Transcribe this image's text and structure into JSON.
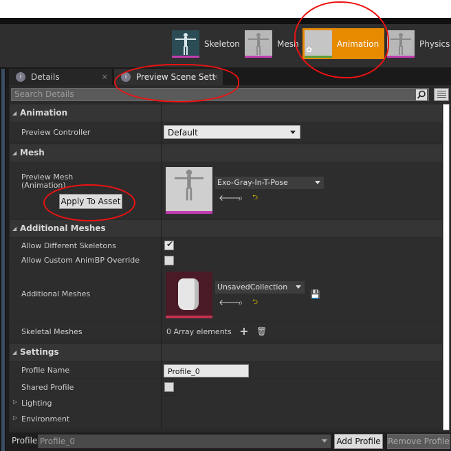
{
  "mode_tabs": [
    {
      "label": "Skeleton",
      "icon": "skeleton-thumb-icon"
    },
    {
      "label": "Mesh",
      "icon": "mesh-thumb-icon"
    },
    {
      "label": "Animation",
      "icon": "animation-thumb-icon",
      "active": true
    },
    {
      "label": "Physics",
      "icon": "physics-thumb-icon"
    }
  ],
  "panel_tabs": [
    {
      "label": "Details",
      "icon": "details-icon"
    },
    {
      "label": "Preview Scene Sett",
      "icon": "preview-scene-icon",
      "active": true
    }
  ],
  "search": {
    "placeholder": "Search Details"
  },
  "sections": {
    "animation": {
      "title": "Animation",
      "preview_controller_label": "Preview Controller",
      "preview_controller_value": "Default"
    },
    "mesh": {
      "title": "Mesh",
      "preview_mesh_label": "Preview Mesh\n(Animation)",
      "apply_button": "Apply To Asset",
      "mesh_value": "Exo-Gray-In-T-Pose"
    },
    "additional_meshes": {
      "title": "Additional Meshes",
      "allow_different_skeletons_label": "Allow Different Skeletons",
      "allow_different_skeletons_checked": true,
      "allow_custom_animbp_label": "Allow Custom AnimBP Override",
      "allow_custom_animbp_checked": false,
      "additional_meshes_label": "Additional Meshes",
      "collection_value": "UnsavedCollection",
      "skeletal_meshes_label": "Skeletal Meshes",
      "skeletal_meshes_value": "0 Array elements"
    },
    "settings": {
      "title": "Settings",
      "profile_name_label": "Profile Name",
      "profile_name_value": "Profile_0",
      "shared_profile_label": "Shared Profile",
      "shared_profile_checked": false,
      "lighting_label": "Lighting",
      "environment_label": "Environment"
    }
  },
  "bottom_bar": {
    "profile_label": "Profile",
    "profile_value": "Profile_0",
    "add_button": "Add Profile",
    "remove_button": "Remove Profile"
  },
  "colors": {
    "accent": "#e68a00",
    "annotation": "#e11111"
  }
}
